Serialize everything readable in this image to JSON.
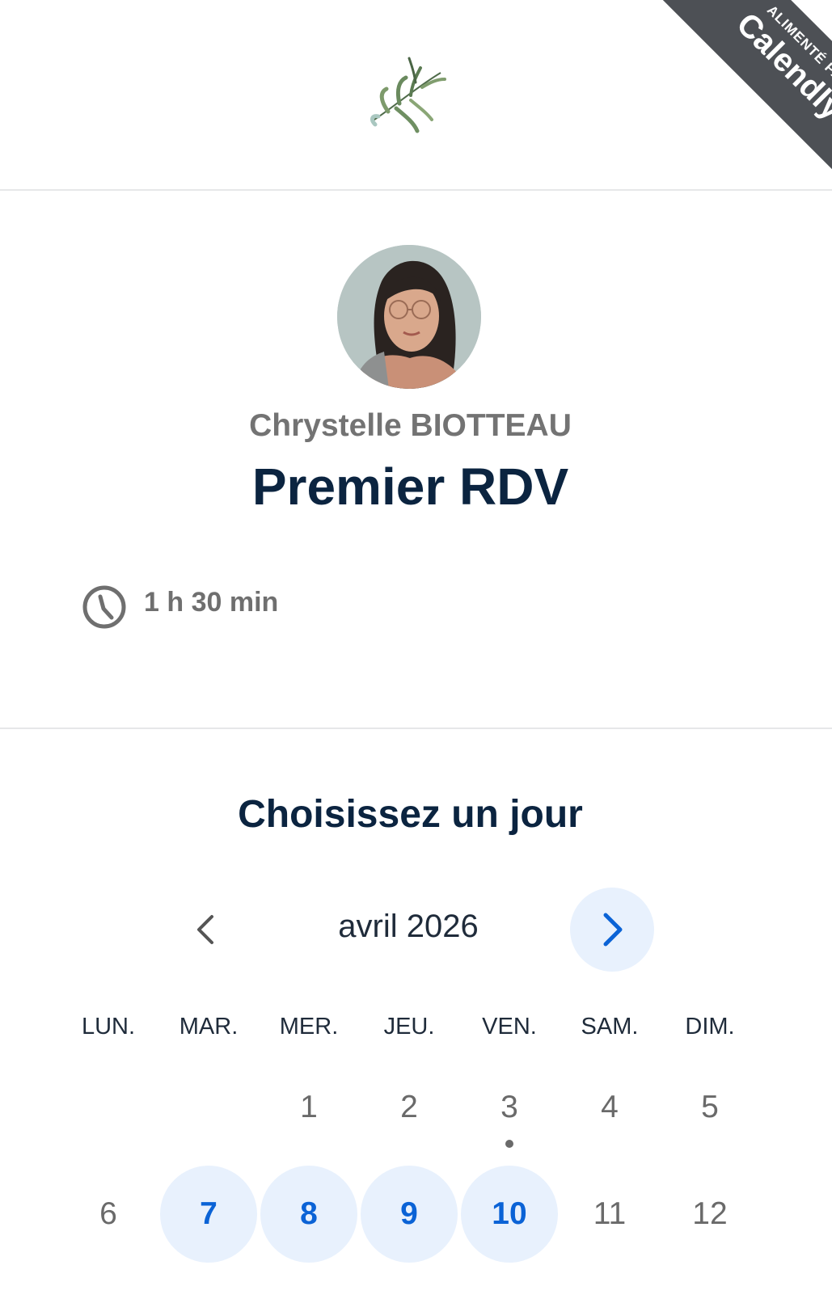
{
  "ribbon": {
    "top_text": "ALIMENTÉ PAR",
    "brand": "Calendly"
  },
  "profile": {
    "organizer": "Chrystelle BIOTTEAU",
    "event_title": "Premier RDV",
    "duration": "1 h 30 min"
  },
  "calendar": {
    "title": "Choisissez un jour",
    "month": "avril 2026",
    "weekdays": [
      "LUN.",
      "MAR.",
      "MER.",
      "JEU.",
      "VEN.",
      "SAM.",
      "DIM."
    ],
    "week1": [
      "1",
      "2",
      "3",
      "4",
      "5"
    ],
    "week2": [
      "6",
      "7",
      "8",
      "9",
      "10",
      "11",
      "12"
    ],
    "available_days": [
      "7",
      "8",
      "9",
      "10"
    ],
    "today": "3"
  },
  "colors": {
    "accent": "#0b63d6",
    "available_bg": "#e8f1fd",
    "title": "#0b2440",
    "ribbon": "#4d5055"
  }
}
